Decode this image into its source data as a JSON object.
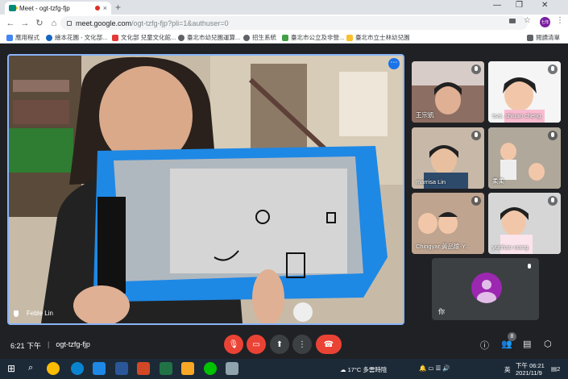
{
  "browser": {
    "tab_title": "Meet - ogt-tzfg-fjp",
    "tab_close": "×",
    "new_tab": "+",
    "url_host": "meet.google.com",
    "url_path": "/ogt-tzfg-fjp?pli=1&authuser=0",
    "profile_initials": "七年",
    "bookmarks": [
      "應用程式",
      "繪本花園 - 文化部...",
      "文化部 兒童文化館...",
      "臺北市幼兒園運算...",
      "招生系統",
      "臺北市公立及非營...",
      "臺北市立士林幼兒園"
    ],
    "reading_list": "閱讀清單"
  },
  "meeting": {
    "main_speaker": "Feble Lin",
    "time": "6:21 下午",
    "separator": "|",
    "code": "ogt-tzfg-fjp",
    "participant_count": "8",
    "self_name": "你"
  },
  "participants": [
    {
      "name": "王宗凱"
    },
    {
      "name": "tsai, shiuan cheng"
    },
    {
      "name": "marrisa Lin"
    },
    {
      "name": "柔柔"
    },
    {
      "name": "Chingyar 黃品瑜-Y..."
    },
    {
      "name": "yunhan wang"
    }
  ],
  "taskbar": {
    "weather": "17°C 多雲時陰",
    "ime": "英",
    "time": "下午 06:21",
    "date": "2021/11/9",
    "notif_count": "2"
  },
  "colors": {
    "accent": "#1a73e8",
    "end_call": "#ea4335",
    "mute_red": "#ea4335",
    "avatar": "#9c27b0",
    "tile_border": "#8ab4f8"
  }
}
